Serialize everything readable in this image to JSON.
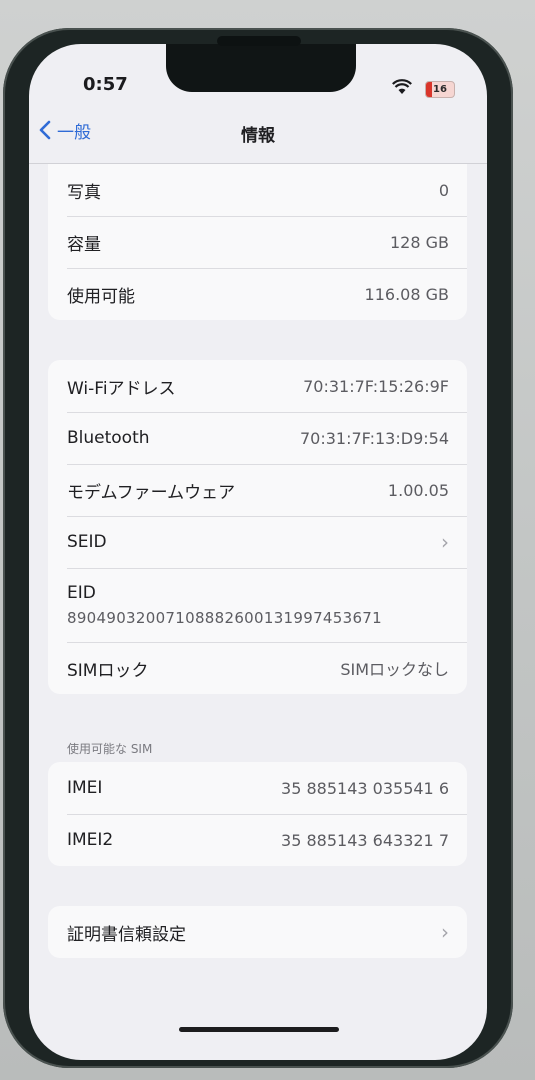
{
  "status_bar": {
    "time": "0:57",
    "battery": "16"
  },
  "nav": {
    "back_label": "一般",
    "title": "情報"
  },
  "group_storage": [
    {
      "label": "写真",
      "value": "0"
    },
    {
      "label": "容量",
      "value": "128 GB"
    },
    {
      "label": "使用可能",
      "value": "116.08 GB"
    }
  ],
  "group_network": {
    "wifi": {
      "label": "Wi-Fiアドレス",
      "value": "70:31:7F:15:26:9F"
    },
    "bluetooth": {
      "label": "Bluetooth",
      "value": "70:31:7F:13:D9:54"
    },
    "modem": {
      "label": "モデムファームウェア",
      "value": "1.00.05"
    },
    "seid": {
      "label": "SEID"
    },
    "eid": {
      "label": "EID",
      "value": "89049032007108882600131997453671"
    },
    "simlock": {
      "label": "SIMロック",
      "value": "SIMロックなし"
    }
  },
  "sim_section": {
    "header": "使用可能な SIM",
    "imei": {
      "label": "IMEI",
      "value": "35 885143 035541 6"
    },
    "imei2": {
      "label": "IMEI2",
      "value": "35 885143 643321 7"
    }
  },
  "certificate": {
    "label": "証明書信頼設定"
  },
  "colors": {
    "accent": "#2f6bd6",
    "battery_low": "#d9352a",
    "background": "#efeff3"
  },
  "icons": [
    "wifi-icon",
    "battery-icon",
    "chevron-left-icon",
    "chevron-right-icon"
  ]
}
